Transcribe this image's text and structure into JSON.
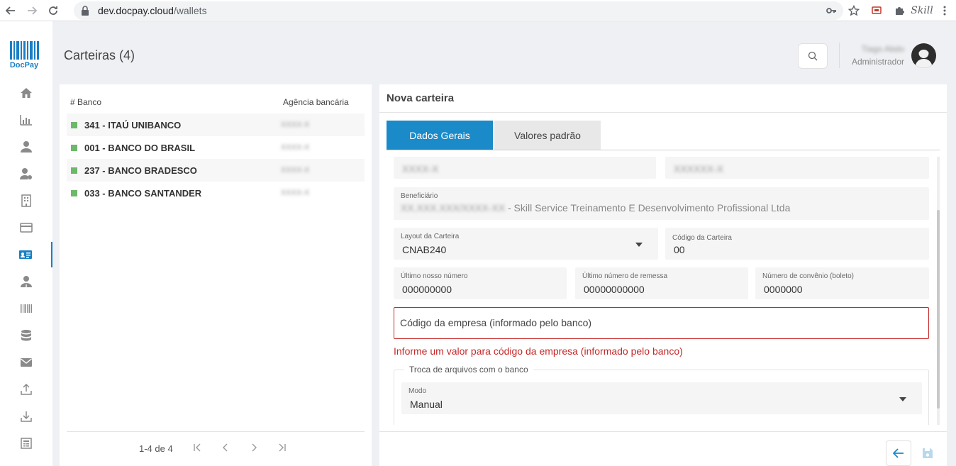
{
  "browser": {
    "url_host": "dev.docpay.cloud",
    "url_path": "/wallets",
    "extension_label": "Skill"
  },
  "sidebar": {
    "brand": "DocPay",
    "accent_color": "#1a7fc4",
    "items": [
      {
        "icon": "home-icon"
      },
      {
        "icon": "bar-chart-icon"
      },
      {
        "icon": "user-icon"
      },
      {
        "icon": "user-settings-icon"
      },
      {
        "icon": "building-icon"
      },
      {
        "icon": "credit-card-icon"
      },
      {
        "icon": "id-card-icon",
        "active": true
      },
      {
        "icon": "manager-icon"
      },
      {
        "icon": "barcode-icon"
      },
      {
        "icon": "database-icon"
      },
      {
        "icon": "mail-icon"
      },
      {
        "icon": "upload-icon"
      },
      {
        "icon": "download-icon"
      },
      {
        "icon": "list-icon"
      }
    ]
  },
  "header": {
    "title": "Carteiras (4)",
    "user_name": "Tiago Abdo",
    "user_role": "Administrador"
  },
  "banks": {
    "columns": [
      "# Banco",
      "Agência bancária"
    ],
    "rows": [
      {
        "name": "341 - ITAÚ UNIBANCO",
        "agency": "XXXX-X"
      },
      {
        "name": "001 - BANCO DO BRASIL",
        "agency": "XXXX-X"
      },
      {
        "name": "237 - BANCO BRADESCO",
        "agency": "XXXX-X"
      },
      {
        "name": "033 - BANCO SANTANDER",
        "agency": "XXXX-X"
      }
    ],
    "status_color": "#6db86a",
    "pager_text": "1-4 de 4"
  },
  "form": {
    "title": "Nova carteira",
    "tabs": [
      "Dados Gerais",
      "Valores padrão"
    ],
    "top_left_value": "XXXX-X",
    "top_right_value": "XXXXXX-X",
    "beneficiario": {
      "label": "Beneficiário",
      "hidden_part": "XX.XXX.XXX/XXXX-XX",
      "value": " - Skill Service Treinamento E Desenvolvimento Profissional Ltda"
    },
    "layout": {
      "label": "Layout da Carteira",
      "value": "CNAB240"
    },
    "codigo_carteira": {
      "label": "Código da Carteira",
      "value": "00"
    },
    "ultimo_nosso_numero": {
      "label": "Último nosso número",
      "value": "000000000"
    },
    "ultimo_remessa": {
      "label": "Último número de remessa",
      "value": "00000000000"
    },
    "convenio": {
      "label": "Número de convênio (boleto)",
      "value": "0000000"
    },
    "codigo_empresa": {
      "placeholder": "Código da empresa (informado pelo banco)"
    },
    "error": "Informe um valor para código da empresa (informado pelo banco)",
    "error_color": "#c62828",
    "troca": {
      "legend": "Troca de arquivos com o banco",
      "modo_label": "Modo",
      "modo_value": "Manual"
    }
  }
}
